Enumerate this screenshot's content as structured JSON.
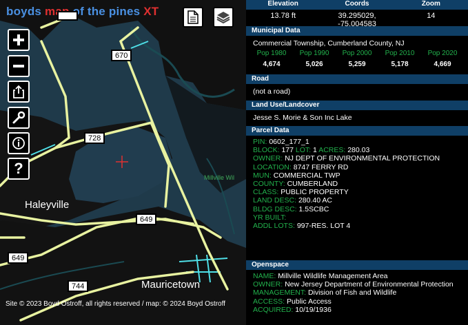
{
  "brand": {
    "part1": "boyds ",
    "part2": "map",
    "part3": " of the pines ",
    "part4": "XT"
  },
  "toolbar": {
    "layers_icon": "layers-icon",
    "doc_icon": "document-icon"
  },
  "controls": [
    {
      "name": "zoom-in-button",
      "icon": "plus-icon"
    },
    {
      "name": "zoom-out-button",
      "icon": "minus-icon"
    },
    {
      "name": "share-button",
      "icon": "share-icon"
    },
    {
      "name": "tools-button",
      "icon": "wrench-icon"
    },
    {
      "name": "info-button",
      "icon": "info-icon"
    },
    {
      "name": "help-button",
      "icon": "question-icon"
    }
  ],
  "map": {
    "shields": [
      "670",
      "728",
      "649",
      "649",
      "744"
    ],
    "places": [
      "Haleyville",
      "Mauricetown"
    ],
    "wma_label": "Millville Wil",
    "attribution": "Site © 2023 Boyd Ostroff, all rights reserved / map: © 2024 Boyd Ostroff",
    "colors": {
      "water": "#1f3a4a",
      "land": "#111111",
      "road": "#e8f2a0",
      "cyan": "#4fe0e8"
    }
  },
  "panel": {
    "top": {
      "labels": [
        "Elevation",
        "Coords",
        "Zoom"
      ],
      "values": [
        "13.78 ft",
        "39.295029, -75.004583",
        "14"
      ]
    },
    "municipal": {
      "title": "Municipal Data",
      "name": "Commercial Township, Cumberland County, NJ",
      "pop_labels": [
        "Pop 1980",
        "Pop 1990",
        "Pop 2000",
        "Pop 2010",
        "Pop 2020"
      ],
      "pop_values": [
        "4,674",
        "5,026",
        "5,259",
        "5,178",
        "4,669"
      ]
    },
    "road": {
      "title": "Road",
      "value": "(not a road)"
    },
    "landuse": {
      "title": "Land Use/Landcover",
      "value": "Jesse S. Morie & Son Inc Lake"
    },
    "parcel": {
      "title": "Parcel Data",
      "pin_label": "PIN:",
      "pin": "0602_177_1",
      "block_label": "BLOCK:",
      "block": "177",
      "lot_label": "LOT:",
      "lot": "1",
      "acres_label": "ACRES:",
      "acres": "280.03",
      "owner_label": "OWNER:",
      "owner": "NJ DEPT OF ENVIRONMENTAL PROTECTION",
      "location_label": "LOCATION:",
      "location": "8747 FERRY RD",
      "mun_label": "MUN:",
      "mun": "COMMERCIAL TWP",
      "county_label": "COUNTY:",
      "county": "CUMBERLAND",
      "class_label": "CLASS:",
      "class": "PUBLIC PROPERTY",
      "landdesc_label": "LAND DESC:",
      "landdesc": "280.40 AC",
      "bldgdesc_label": "BLDG DESC:",
      "bldgdesc": "1.5SCBC",
      "yrbuilt_label": "YR BUILT:",
      "yrbuilt": "",
      "addl_label": "ADDL LOTS:",
      "addl": "997-RES. LOT 4"
    },
    "openspace": {
      "title": "Openspace",
      "name_label": "NAME:",
      "name": "Millville Wildlife Management Area",
      "owner_label": "OWNER:",
      "owner": "New Jersey Department of Environmental Protection",
      "mgmt_label": "MANAGEMENT:",
      "mgmt": "Division of Fish and Wildlife",
      "access_label": "ACCESS:",
      "access": "Public Access",
      "acquired_label": "ACQUIRED:",
      "acquired": "10/19/1936"
    }
  }
}
